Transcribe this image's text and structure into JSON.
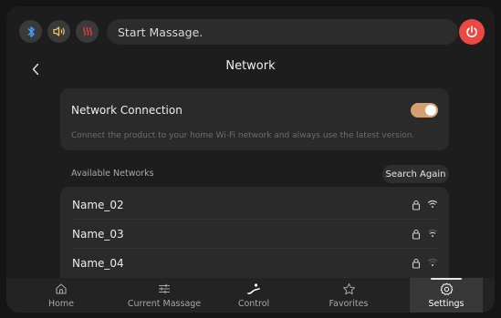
{
  "topbar": {
    "status_message": "Start Massage.",
    "icons": [
      "bluetooth-icon",
      "volume-icon",
      "heat-icon",
      "power-icon"
    ],
    "colors": {
      "bluetooth": "#3aa0ff",
      "volume": "#f0c070",
      "heat": "#e0473f",
      "power": "#ea4a43"
    }
  },
  "header": {
    "title": "Network"
  },
  "network_connection": {
    "title": "Network Connection",
    "description": "Connect the product to your home Wi-Fi network and always use the latest version.",
    "enabled": true,
    "toggle_color": "#d4a06d"
  },
  "available_networks": {
    "label": "Available Networks",
    "search_button": "Search Again",
    "items": [
      {
        "name": "Name_02",
        "locked": true,
        "signal": 3
      },
      {
        "name": "Name_03",
        "locked": true,
        "signal": 2
      },
      {
        "name": "Name_04",
        "locked": true,
        "signal": 1
      }
    ]
  },
  "bottom_nav": {
    "items": [
      {
        "label": "Home",
        "icon": "home-icon"
      },
      {
        "label": "Current Massage",
        "icon": "sliders-icon"
      },
      {
        "label": "Control",
        "icon": "control-icon"
      },
      {
        "label": "Favorites",
        "icon": "star-icon"
      },
      {
        "label": "Settings",
        "icon": "gear-icon",
        "active": true
      }
    ]
  }
}
